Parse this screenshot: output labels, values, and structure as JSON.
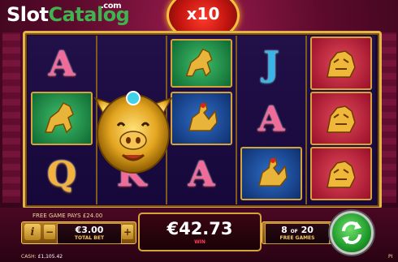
{
  "logo": {
    "part1": "Slot",
    "part2": "Catalog",
    "suffix": ".com"
  },
  "multiplier": {
    "label": "x10"
  },
  "reels": {
    "reel1": [
      "A",
      "",
      "Q"
    ],
    "reel2": [
      "",
      "",
      "K"
    ],
    "reel3": [
      "J",
      "",
      ""
    ],
    "reel4": [
      "",
      "A",
      ""
    ],
    "reel5": [
      "",
      "",
      ""
    ]
  },
  "bottom": {
    "free_game_pays": "FREE GAME PAYS £24.00",
    "info_label": "i",
    "minus_label": "−",
    "plus_label": "+",
    "total_bet_value": "€3.00",
    "total_bet_label": "TOTAL BET",
    "win_value": "€42.73",
    "win_label": "WIN",
    "free_games_current": "8",
    "free_games_of": "OF",
    "free_games_total": "20",
    "free_games_label": "FREE GAMES",
    "cash_label": "CASH:",
    "cash_value": "£1,105.42",
    "corner_text": "PI"
  },
  "colors": {
    "frame_gold": "#e2b54a",
    "background": "#5a0a2e",
    "spin_green": "#1e9a2a",
    "win_label_red": "#ff3b5a"
  },
  "icons": {
    "spin": "refresh-arrows-icon",
    "info": "info-icon"
  }
}
